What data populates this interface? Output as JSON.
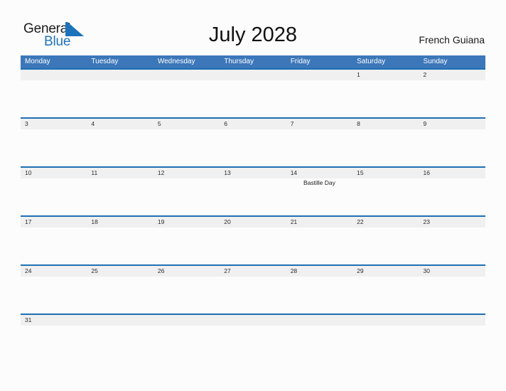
{
  "header": {
    "logo_primary": "General",
    "logo_secondary": "Blue",
    "logo_flag_icon": "blue-triangle-flag-icon",
    "title": "July 2028",
    "country": "French Guiana"
  },
  "colors": {
    "header_bar": "#3c77b9",
    "row_divider": "#1f6fb2",
    "daynum_band": "#f0f0f0",
    "logo_blue": "#1d73bb",
    "page_background": "#fcfcfc"
  },
  "calendar": {
    "month": "July",
    "year": "2028",
    "weekday_headers": [
      "Monday",
      "Tuesday",
      "Wednesday",
      "Thursday",
      "Friday",
      "Saturday",
      "Sunday"
    ],
    "weeks": [
      {
        "days": [
          {
            "num": "",
            "event": ""
          },
          {
            "num": "",
            "event": ""
          },
          {
            "num": "",
            "event": ""
          },
          {
            "num": "",
            "event": ""
          },
          {
            "num": "",
            "event": ""
          },
          {
            "num": "1",
            "event": ""
          },
          {
            "num": "2",
            "event": ""
          }
        ]
      },
      {
        "days": [
          {
            "num": "3",
            "event": ""
          },
          {
            "num": "4",
            "event": ""
          },
          {
            "num": "5",
            "event": ""
          },
          {
            "num": "6",
            "event": ""
          },
          {
            "num": "7",
            "event": ""
          },
          {
            "num": "8",
            "event": ""
          },
          {
            "num": "9",
            "event": ""
          }
        ]
      },
      {
        "days": [
          {
            "num": "10",
            "event": ""
          },
          {
            "num": "11",
            "event": ""
          },
          {
            "num": "12",
            "event": ""
          },
          {
            "num": "13",
            "event": ""
          },
          {
            "num": "14",
            "event": "Bastille Day"
          },
          {
            "num": "15",
            "event": ""
          },
          {
            "num": "16",
            "event": ""
          }
        ]
      },
      {
        "days": [
          {
            "num": "17",
            "event": ""
          },
          {
            "num": "18",
            "event": ""
          },
          {
            "num": "19",
            "event": ""
          },
          {
            "num": "20",
            "event": ""
          },
          {
            "num": "21",
            "event": ""
          },
          {
            "num": "22",
            "event": ""
          },
          {
            "num": "23",
            "event": ""
          }
        ]
      },
      {
        "days": [
          {
            "num": "24",
            "event": ""
          },
          {
            "num": "25",
            "event": ""
          },
          {
            "num": "26",
            "event": ""
          },
          {
            "num": "27",
            "event": ""
          },
          {
            "num": "28",
            "event": ""
          },
          {
            "num": "29",
            "event": ""
          },
          {
            "num": "30",
            "event": ""
          }
        ]
      },
      {
        "days": [
          {
            "num": "31",
            "event": ""
          },
          {
            "num": "",
            "event": ""
          },
          {
            "num": "",
            "event": ""
          },
          {
            "num": "",
            "event": ""
          },
          {
            "num": "",
            "event": ""
          },
          {
            "num": "",
            "event": ""
          },
          {
            "num": "",
            "event": ""
          }
        ]
      }
    ]
  }
}
